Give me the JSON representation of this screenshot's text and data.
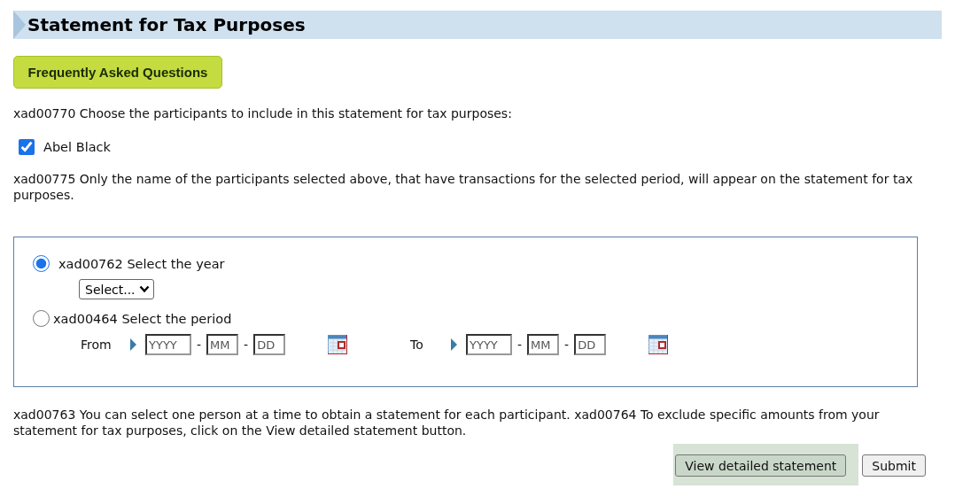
{
  "header": {
    "title": "Statement for Tax Purposes"
  },
  "faq_button": "Frequently Asked Questions",
  "participants": {
    "prompt": "xad00770 Choose the participants to include in this statement for tax purposes:",
    "items": [
      {
        "name": "Abel Black",
        "checked": true
      }
    ],
    "note": "xad00775 Only the name of the participants selected above, that have transactions for the selected period, will appear on the statement for tax purposes."
  },
  "options": [
    {
      "kind": "year",
      "label": "xad00762 Select the year",
      "selected": true,
      "select": "Select..."
    },
    {
      "kind": "period",
      "label": "xad00464 Select the period",
      "selected": false,
      "ranges": [
        {
          "label": "From",
          "separator": "-",
          "parts": [
            {
              "placeholder": "YYYY"
            },
            {
              "placeholder": "MM"
            },
            {
              "placeholder": "DD"
            }
          ]
        },
        {
          "label": "To",
          "separator": "-",
          "parts": [
            {
              "placeholder": "YYYY"
            },
            {
              "placeholder": "MM"
            },
            {
              "placeholder": "DD"
            }
          ]
        }
      ]
    }
  ],
  "footer_note": "xad00763 You can select one person at a time to obtain a statement for each participant. xad00764 To exclude specific amounts from your statement for tax purposes, click on the View detailed statement button.",
  "buttons": [
    {
      "label": "View detailed statement",
      "highlighted": true
    },
    {
      "label": "Submit",
      "highlighted": false
    }
  ]
}
